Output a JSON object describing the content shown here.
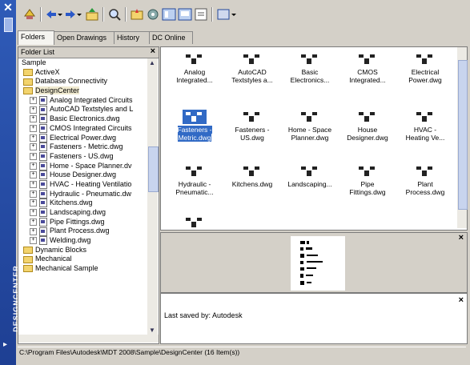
{
  "palette": {
    "title": "DESIGNCENTER"
  },
  "tabs": [
    "Folders",
    "Open Drawings",
    "History",
    "DC Online"
  ],
  "folder_panel": {
    "header": "Folder List",
    "rows": [
      {
        "label": "Sample",
        "kind": "root"
      },
      {
        "label": "ActiveX",
        "kind": "folder"
      },
      {
        "label": "Database Connectivity",
        "kind": "folder"
      },
      {
        "label": "DesignCenter",
        "kind": "folder-open"
      },
      {
        "label": "Analog Integrated Circuits",
        "kind": "dwg"
      },
      {
        "label": "AutoCAD Textstyles and L",
        "kind": "dwg"
      },
      {
        "label": "Basic Electronics.dwg",
        "kind": "dwg"
      },
      {
        "label": "CMOS Integrated Circuits",
        "kind": "dwg"
      },
      {
        "label": "Electrical Power.dwg",
        "kind": "dwg"
      },
      {
        "label": "Fasteners - Metric.dwg",
        "kind": "dwg"
      },
      {
        "label": "Fasteners - US.dwg",
        "kind": "dwg"
      },
      {
        "label": "Home - Space Planner.dv",
        "kind": "dwg"
      },
      {
        "label": "House Designer.dwg",
        "kind": "dwg"
      },
      {
        "label": "HVAC - Heating Ventilatio",
        "kind": "dwg"
      },
      {
        "label": "Hydraulic - Pneumatic.dw",
        "kind": "dwg"
      },
      {
        "label": "Kitchens.dwg",
        "kind": "dwg"
      },
      {
        "label": "Landscaping.dwg",
        "kind": "dwg"
      },
      {
        "label": "Pipe Fittings.dwg",
        "kind": "dwg"
      },
      {
        "label": "Plant Process.dwg",
        "kind": "dwg"
      },
      {
        "label": "Welding.dwg",
        "kind": "dwg"
      },
      {
        "label": "Dynamic Blocks",
        "kind": "folder"
      },
      {
        "label": "Mechanical",
        "kind": "folder"
      },
      {
        "label": "Mechanical Sample",
        "kind": "folder"
      }
    ]
  },
  "content_items": [
    {
      "cap1": "Analog",
      "cap2": "Integrated..."
    },
    {
      "cap1": "AutoCAD",
      "cap2": "Textstyles a..."
    },
    {
      "cap1": "Basic",
      "cap2": "Electronics..."
    },
    {
      "cap1": "CMOS",
      "cap2": "Integrated..."
    },
    {
      "cap1": "Electrical",
      "cap2": "Power.dwg"
    },
    {
      "cap1": "Fasteners -",
      "cap2": "Metric.dwg",
      "selected": true
    },
    {
      "cap1": "Fasteners -",
      "cap2": "US.dwg"
    },
    {
      "cap1": "Home - Space",
      "cap2": "Planner.dwg"
    },
    {
      "cap1": "House",
      "cap2": "Designer.dwg"
    },
    {
      "cap1": "HVAC -",
      "cap2": "Heating Ve..."
    },
    {
      "cap1": "Hydraulic -",
      "cap2": "Pneumatic..."
    },
    {
      "cap1": "Kitchens.dwg",
      "cap2": ""
    },
    {
      "cap1": "Landscaping...",
      "cap2": ""
    },
    {
      "cap1": "Pipe",
      "cap2": "Fittings.dwg"
    },
    {
      "cap1": "Plant",
      "cap2": "Process.dwg"
    },
    {
      "cap1": "",
      "cap2": ""
    }
  ],
  "description": {
    "text": "Last saved by: Autodesk"
  },
  "status": {
    "path": "C:\\Program Files\\Autodesk\\MDT 2008\\Sample\\DesignCenter (16 Item(s))"
  },
  "colors": {
    "palette_blue": "#2f5bb8",
    "selection": "#316ac5",
    "window_bg": "#d4d0c8"
  }
}
